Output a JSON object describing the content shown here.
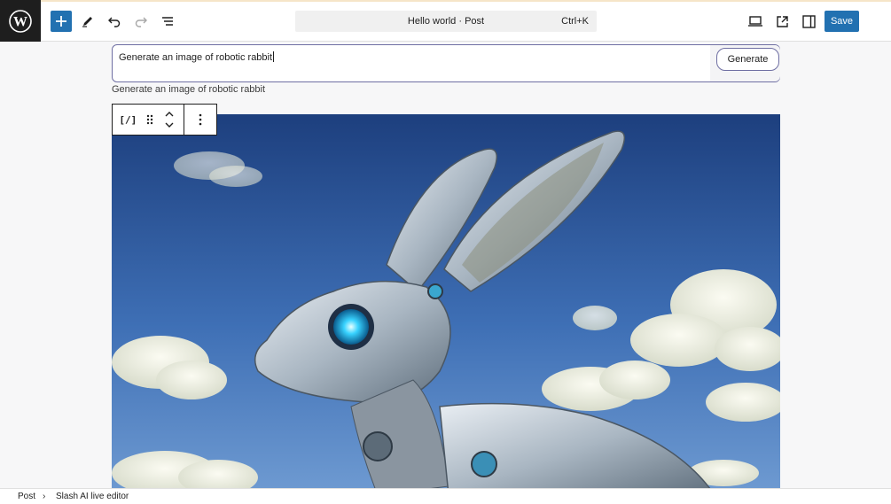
{
  "topbar": {
    "document_title": "Hello world · Post",
    "shortcut": "Ctrl+K",
    "save_label": "Save",
    "icons": [
      "wordpress-logo",
      "add-block",
      "edit-pen",
      "undo",
      "redo",
      "list-view",
      "preview-desktop",
      "external-link",
      "settings-sidebar"
    ],
    "accent_color": "#2271b1"
  },
  "prompt": {
    "value": "Generate an image of robotic rabbit",
    "generate_label": "Generate"
  },
  "caption": "Generate an image of robotic rabbit",
  "block_toolbar": {
    "type_label": "[/]",
    "icons": [
      "block-type",
      "drag-handle",
      "move-up",
      "move-down",
      "more-options"
    ]
  },
  "image": {
    "subject": "robotic rabbit"
  },
  "breadcrumb": {
    "items": [
      "Post",
      "Slash AI live editor"
    ]
  }
}
